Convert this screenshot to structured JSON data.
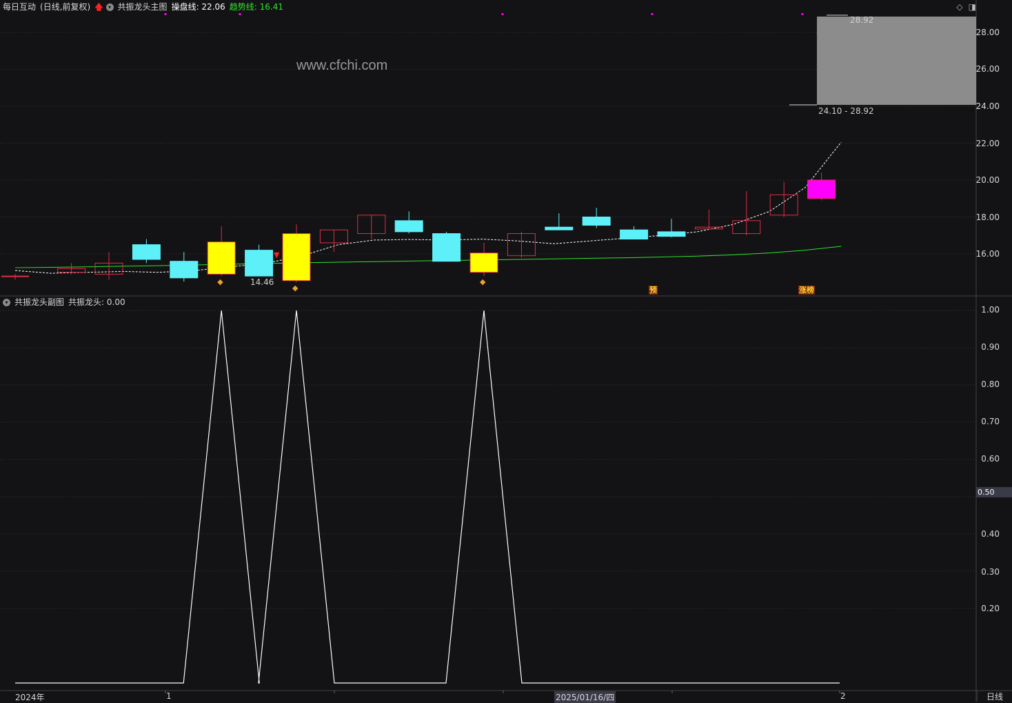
{
  "main_header": {
    "stock": "每日互动",
    "period_mode": "(日线,前复权)",
    "indicator_name": "共振龙头主图",
    "line1_label": "操盘线: 22.06",
    "line2_label": "趋势线: 16.41"
  },
  "sub_header": {
    "indicator_name": "共振龙头副图",
    "value_label": "共振龙头: 0.00"
  },
  "watermark": "www.cfchi.com",
  "main_y_ticks": [
    "28.00",
    "26.00",
    "24.00",
    "22.00",
    "20.00",
    "18.00",
    "16.00"
  ],
  "sub_y_ticks": [
    "1.00",
    "0.90",
    "0.80",
    "0.70",
    "0.60",
    "0.40",
    "0.30",
    "0.20"
  ],
  "sub_current_value": "0.50",
  "dates": {
    "start": "2024年",
    "mark1": "1",
    "mid": "2025/01/16/四",
    "mark2": "2"
  },
  "period_button": "日线",
  "price_labels": {
    "high": "28.92",
    "range": "24.10 - 28.92",
    "low": "14.46"
  },
  "signal_tags": {
    "pre": "预",
    "limit_up": "涨榜"
  },
  "colors": {
    "bg": "#131214",
    "up": "#e0304a",
    "down": "#5ef0f8",
    "signal_yellow": "#ffff00",
    "limit_magenta": "#ff00ff",
    "trend_green": "#2ee62e",
    "grid": "#3a3a3a"
  },
  "chart_data": {
    "type": "candlestick",
    "y_range": [
      14.2,
      29.9
    ],
    "candles": [
      {
        "o": 14.72,
        "h": 14.9,
        "l": 14.6,
        "c": 14.78,
        "kind": "up"
      },
      {
        "o": 15.0,
        "h": 15.5,
        "l": 14.9,
        "c": 15.2,
        "kind": "up"
      },
      {
        "o": 14.9,
        "h": 16.1,
        "l": 14.6,
        "c": 15.5,
        "kind": "up"
      },
      {
        "o": 16.5,
        "h": 16.8,
        "l": 15.5,
        "c": 15.7,
        "kind": "down"
      },
      {
        "o": 15.6,
        "h": 16.1,
        "l": 14.5,
        "c": 14.7,
        "kind": "down"
      },
      {
        "o": 14.9,
        "h": 17.5,
        "l": 14.8,
        "c": 16.65,
        "kind": "signal-up"
      },
      {
        "o": 16.2,
        "h": 16.5,
        "l": 14.8,
        "c": 14.8,
        "kind": "down"
      },
      {
        "o": 14.55,
        "h": 17.6,
        "l": 14.46,
        "c": 17.1,
        "kind": "signal-up"
      },
      {
        "o": 16.6,
        "h": 17.3,
        "l": 16.1,
        "c": 17.3,
        "kind": "up"
      },
      {
        "o": 17.1,
        "h": 18.1,
        "l": 16.8,
        "c": 18.1,
        "kind": "up"
      },
      {
        "o": 17.8,
        "h": 18.3,
        "l": 17.1,
        "c": 17.2,
        "kind": "down"
      },
      {
        "o": 17.1,
        "h": 17.2,
        "l": 15.6,
        "c": 15.6,
        "kind": "down"
      },
      {
        "o": 15.0,
        "h": 16.6,
        "l": 14.8,
        "c": 16.05,
        "kind": "signal-up"
      },
      {
        "o": 15.9,
        "h": 17.2,
        "l": 15.8,
        "c": 17.1,
        "kind": "up"
      },
      {
        "o": 17.45,
        "h": 18.2,
        "l": 17.3,
        "c": 17.3,
        "kind": "down"
      },
      {
        "o": 18.0,
        "h": 18.5,
        "l": 17.4,
        "c": 17.55,
        "kind": "down"
      },
      {
        "o": 17.3,
        "h": 17.5,
        "l": 16.8,
        "c": 16.8,
        "kind": "down"
      },
      {
        "o": 17.2,
        "h": 17.9,
        "l": 16.9,
        "c": 16.95,
        "kind": "down"
      },
      {
        "o": 17.35,
        "h": 18.4,
        "l": 17.3,
        "c": 17.45,
        "kind": "up"
      },
      {
        "o": 17.1,
        "h": 19.4,
        "l": 17.0,
        "c": 17.8,
        "kind": "up"
      },
      {
        "o": 18.1,
        "h": 19.9,
        "l": 18.0,
        "c": 19.2,
        "kind": "up"
      },
      {
        "o": 19.0,
        "h": 20.4,
        "l": 18.9,
        "c": 20.0,
        "kind": "limit-up"
      }
    ],
    "operating_line": [
      15.1,
      14.95,
      15.0,
      15.05,
      15.0,
      15.1,
      15.3,
      15.5,
      15.9,
      16.5,
      16.75,
      16.78,
      16.75,
      16.8,
      16.7,
      16.55,
      16.7,
      16.85,
      17.0,
      17.2,
      17.6,
      18.3,
      19.6,
      22.06
    ],
    "trend_line": [
      15.25,
      15.27,
      15.3,
      15.33,
      15.36,
      15.4,
      15.44,
      15.48,
      15.52,
      15.55,
      15.58,
      15.61,
      15.64,
      15.67,
      15.7,
      15.73,
      15.76,
      15.79,
      15.83,
      15.88,
      15.95,
      16.05,
      16.2,
      16.41
    ],
    "sub_indicator": {
      "y_range": [
        0,
        1
      ],
      "values": [
        0,
        0,
        0,
        0,
        0,
        1,
        0,
        1,
        0,
        0,
        0,
        0,
        1,
        0,
        0,
        0,
        0,
        0,
        0,
        0,
        0,
        0
      ]
    }
  }
}
